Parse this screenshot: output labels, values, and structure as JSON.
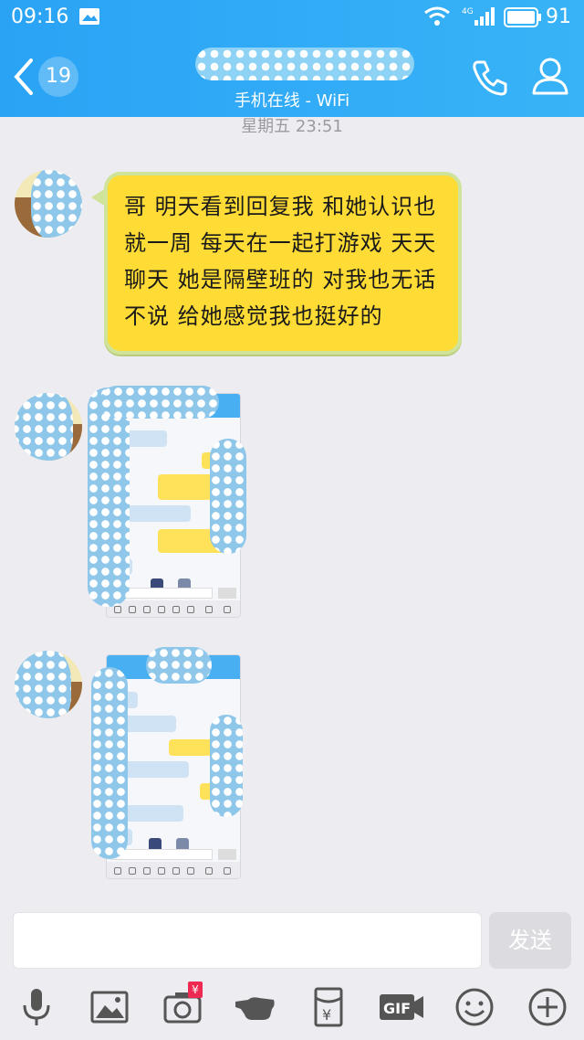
{
  "status_bar": {
    "time": "09:16",
    "network": "4G",
    "battery": "91"
  },
  "header": {
    "unread_badge": "19",
    "subtitle": "手机在线 - WiFi"
  },
  "timestamp": "星期五 23:51",
  "message": {
    "text": "哥  明天看到回复我  和她认识也就一周  每天在一起打游戏  天天聊天  她是隔壁班的  对我也无话不说  给她感觉我也挺好的"
  },
  "input": {
    "placeholder": "",
    "send_label": "发送"
  },
  "toolbar_icons": [
    "microphone-icon",
    "image-icon",
    "camera-icon",
    "poke-icon",
    "red-packet-icon",
    "gif-icon",
    "emoji-icon",
    "plus-icon"
  ],
  "colors": {
    "header": "#2aa3f5",
    "bubble": "#ffdc35",
    "background": "#ededf1"
  }
}
